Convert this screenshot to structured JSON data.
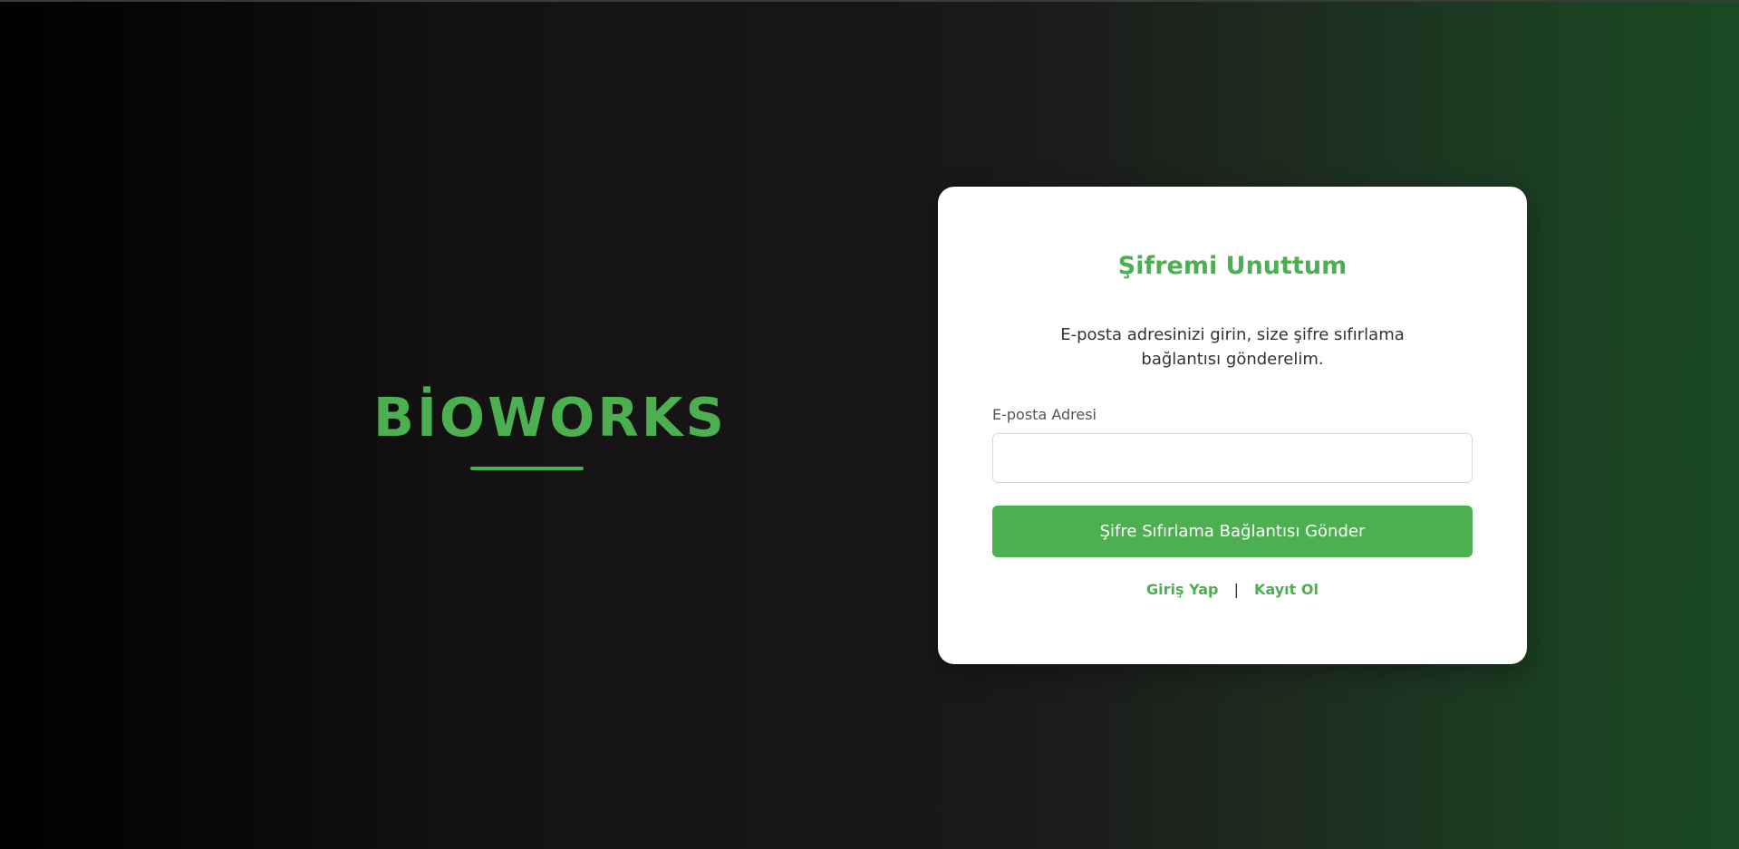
{
  "brand": {
    "title": "BİOWORKS"
  },
  "form": {
    "title": "Şifremi Unuttum",
    "description": "E-posta adresinizi girin, size şifre sıfırlama bağlantısı gönderelim.",
    "email_label": "E-posta Adresi",
    "email_value": "",
    "email_placeholder": "",
    "submit_label": "Şifre Sıfırlama Bağlantısı Gönder"
  },
  "links": {
    "login_label": "Giriş Yap",
    "separator": "|",
    "register_label": "Kayıt Ol"
  },
  "colors": {
    "accent": "#4caf50",
    "card_background": "#ffffff",
    "page_gradient_start": "#000000",
    "page_gradient_end": "#1a4a23"
  }
}
